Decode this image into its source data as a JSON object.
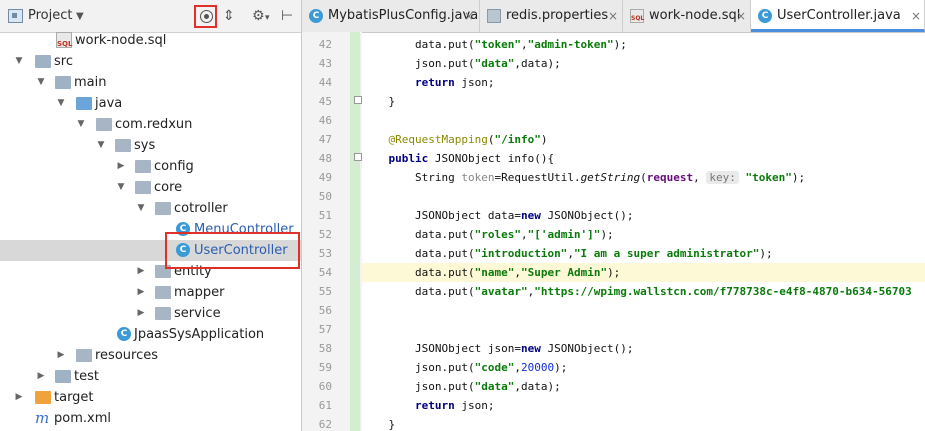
{
  "project_panel": {
    "title": "Project",
    "tree": [
      {
        "label": "work-node.sql",
        "icon": "sql-file-icon",
        "kind": "sql"
      },
      {
        "label": "src",
        "icon": "folder-icon",
        "kind": "folder"
      },
      {
        "label": "main",
        "icon": "folder-icon",
        "kind": "folder"
      },
      {
        "label": "java",
        "icon": "source-folder-icon",
        "kind": "java"
      },
      {
        "label": "com.redxun",
        "icon": "package-icon",
        "kind": "pkg"
      },
      {
        "label": "sys",
        "icon": "package-icon",
        "kind": "pkg"
      },
      {
        "label": "config",
        "icon": "package-icon",
        "kind": "pkg"
      },
      {
        "label": "core",
        "icon": "package-icon",
        "kind": "pkg"
      },
      {
        "label": "cotroller",
        "icon": "package-icon",
        "kind": "pkg"
      },
      {
        "label": "MenuController",
        "icon": "java-class-icon",
        "kind": "class"
      },
      {
        "label": "UserController",
        "icon": "java-class-icon",
        "kind": "class"
      },
      {
        "label": "entity",
        "icon": "package-icon",
        "kind": "pkg"
      },
      {
        "label": "mapper",
        "icon": "package-icon",
        "kind": "pkg"
      },
      {
        "label": "service",
        "icon": "package-icon",
        "kind": "pkg"
      },
      {
        "label": "JpaasSysApplication",
        "icon": "spring-app-icon",
        "kind": "app"
      },
      {
        "label": "resources",
        "icon": "resources-folder-icon",
        "kind": "res"
      },
      {
        "label": "test",
        "icon": "folder-icon",
        "kind": "folder"
      },
      {
        "label": "target",
        "icon": "target-folder-icon",
        "kind": "target"
      },
      {
        "label": "pom.xml",
        "icon": "maven-icon",
        "kind": "maven"
      }
    ]
  },
  "tabs": [
    {
      "label": "MybatisPlusConfig.java",
      "icon": "java-class-icon"
    },
    {
      "label": "redis.properties",
      "icon": "properties-file-icon"
    },
    {
      "label": "work-node.sql",
      "icon": "sql-file-icon"
    },
    {
      "label": "UserController.java",
      "icon": "java-class-icon",
      "active": true
    }
  ],
  "editor": {
    "line_numbers": [
      "42",
      "43",
      "44",
      "45",
      "46",
      "47",
      "48",
      "49",
      "50",
      "51",
      "52",
      "53",
      "54",
      "55",
      "56",
      "57",
      "58",
      "59",
      "60",
      "61",
      "62"
    ],
    "current_line": "54",
    "hint_key": "key:",
    "lines": {
      "l42": [
        "data.put(",
        "\"token\"",
        ",",
        "\"admin-token\"",
        ");"
      ],
      "l43": [
        "json.put(",
        "\"data\"",
        ",data);"
      ],
      "l44": [
        "return",
        " json;"
      ],
      "l45": [
        "}"
      ],
      "l47": [
        "@RequestMapping",
        "(",
        "\"/info\"",
        ")"
      ],
      "l48": [
        "public",
        " JSONObject info(){"
      ],
      "l49": [
        "String ",
        "token",
        "=RequestUtil.",
        "getString",
        "(",
        "request",
        ", ",
        "\"token\"",
        ");"
      ],
      "l51": [
        "JSONObject data=",
        "new",
        " JSONObject();"
      ],
      "l52": [
        "data.put(",
        "\"roles\"",
        ",",
        "\"['admin']\"",
        ");"
      ],
      "l53": [
        "data.put(",
        "\"introduction\"",
        ",",
        "\"I am a super administrator\"",
        ");"
      ],
      "l54": [
        "data.put(",
        "\"name\"",
        ",",
        "\"Super Admin\"",
        ");"
      ],
      "l55": [
        "data.put(",
        "\"avatar\"",
        ",",
        "\"https://wpimg.wallstcn.com/f778738c-e4f8-4870-b634-56703"
      ],
      "l58": [
        "JSONObject json=",
        "new",
        " JSONObject();"
      ],
      "l59": [
        "json.put(",
        "\"code\"",
        ",",
        "20000",
        ");"
      ],
      "l60": [
        "json.put(",
        "\"data\"",
        ",data);"
      ],
      "l61": [
        "return",
        " json;"
      ],
      "l62": [
        "}"
      ]
    }
  },
  "colors": {
    "highlight_box": "#e0302a",
    "active_tab_underline": "#4a8fe0",
    "class_icon": "#3c9ad6"
  }
}
